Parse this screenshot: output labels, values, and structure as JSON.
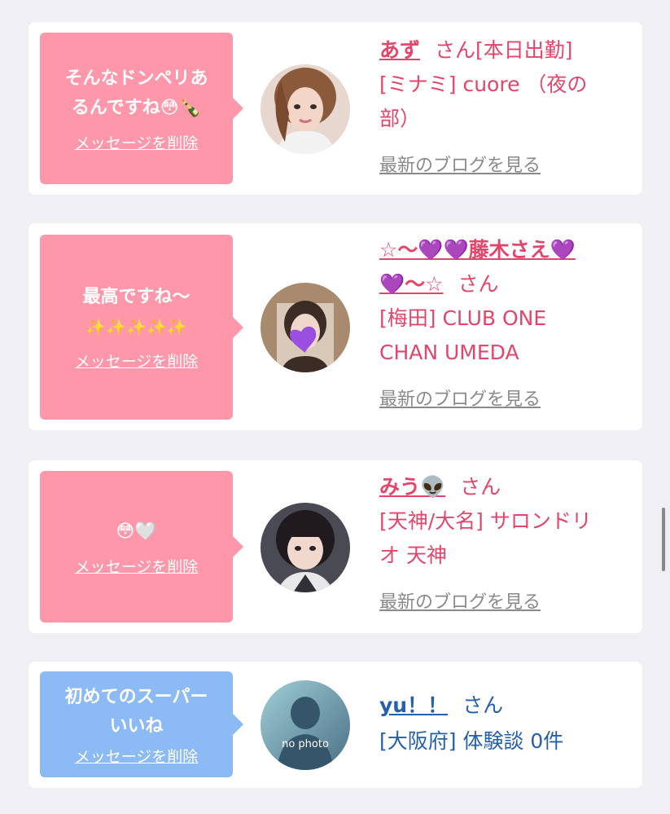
{
  "cards": [
    {
      "message_line1": "そんなドンペリあ",
      "message_line2": "るんですね😳🍾",
      "delete_label": "メッセージを削除",
      "name": "あず",
      "san": "さん[本日出勤]",
      "shop_line1": "[ミナミ] cuore （夜の",
      "shop_line2": "部）",
      "blog_label": "最新のブログを見る"
    },
    {
      "message_line1": "最高ですね〜",
      "message_line2": "✨✨✨✨✨",
      "delete_label": "メッセージを削除",
      "name_line1": "☆〜💜💜藤木さえ💜",
      "name_line2": "💜〜☆",
      "san": "さん",
      "shop_line1": "[梅田] CLUB ONE",
      "shop_line2": "CHAN UMEDA",
      "blog_label": "最新のブログを見る"
    },
    {
      "message_line1": "😳🤍",
      "delete_label": "メッセージを削除",
      "name": "みう👽",
      "san": "さん",
      "shop_line1": "[天神/大名] サロンドリ",
      "shop_line2": "オ 天神",
      "blog_label": "最新のブログを見る"
    },
    {
      "message_line1": "初めてのスーパー",
      "message_line2": "いいね",
      "delete_label": "メッセージを削除",
      "avatar_text": "no photo",
      "name": "yu！！",
      "san": "さん",
      "shop_line1": "[大阪府] 体験談 0件"
    }
  ],
  "colors": {
    "pink_bubble": "#fe97a9",
    "blue_bubble": "#8bbaf4",
    "pink_text": "#e4456a",
    "blue_text": "#2460ad"
  }
}
